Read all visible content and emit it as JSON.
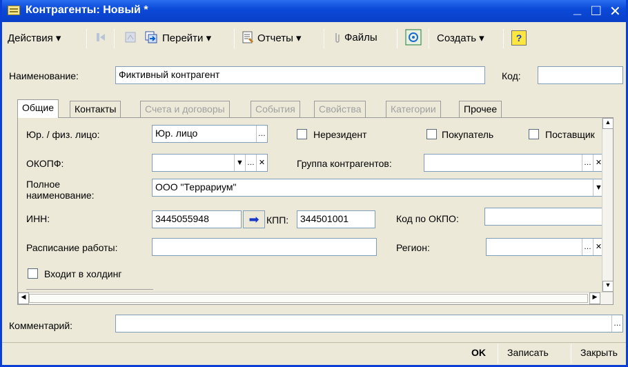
{
  "window": {
    "title": "Контрагенты: Новый *",
    "minimize": "_",
    "maximize": "□",
    "close": "✕"
  },
  "toolbar": {
    "actions": "Действия",
    "goto": "Перейти",
    "reports": "Отчеты",
    "files": "Файлы",
    "create": "Создать",
    "help": "?"
  },
  "header": {
    "name_label": "Наименование:",
    "name_value": "Фиктивный контрагент",
    "code_label": "Код:",
    "code_value": ""
  },
  "tabs": [
    "Общие",
    "Контакты",
    "Счета и договоры",
    "События",
    "Свойства",
    "Категории",
    "Прочее"
  ],
  "form": {
    "entity_label": "Юр. / физ. лицо:",
    "entity_value": "Юр. лицо",
    "nonresident_label": "Нерезидент",
    "buyer_label": "Покупатель",
    "supplier_label": "Поставщик",
    "okopf_label": "ОКОПФ:",
    "okopf_value": "",
    "group_label": "Группа контрагентов:",
    "group_value": "",
    "fullname_label_1": "Полное",
    "fullname_label_2": "наименование:",
    "fullname_value": "ООО \"Террариум\"",
    "inn_label": "ИНН:",
    "inn_value": "3445055948",
    "kpp_label": "КПП:",
    "kpp_value": "344501001",
    "okpo_label": "Код по ОКПО:",
    "okpo_value": "",
    "schedule_label": "Расписание работы:",
    "schedule_value": "",
    "region_label": "Регион:",
    "region_value": "",
    "holding_label": "Входит в холдинг"
  },
  "comment": {
    "label": "Комментарий:",
    "value": ""
  },
  "footer": {
    "ok": "OK",
    "save": "Записать",
    "close": "Закрыть"
  }
}
